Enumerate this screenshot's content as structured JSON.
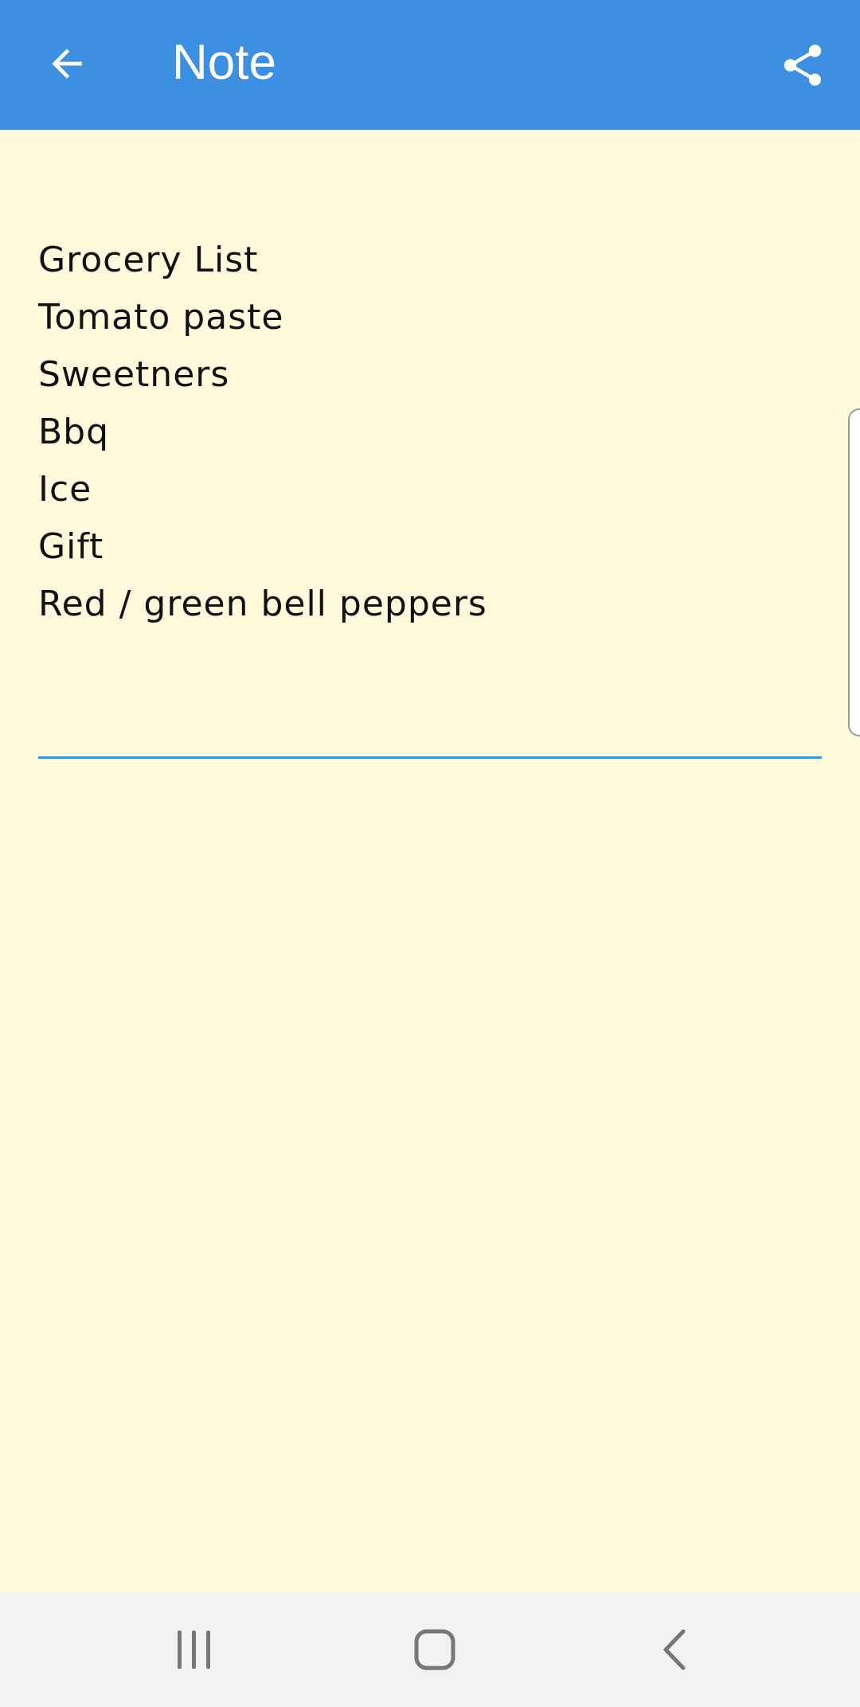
{
  "app_bar": {
    "title": "Note",
    "back_icon": "arrow-left-icon",
    "share_icon": "share-icon",
    "background_color": "#3D8FE2"
  },
  "note": {
    "lines": [
      "Grocery List",
      "Tomato paste",
      "Sweetners",
      "Bbq",
      "Ice",
      "Gift",
      "Red / green bell peppers"
    ],
    "background_color": "#FFFADC",
    "underline_color": "#3A9AD9"
  },
  "nav_bar": {
    "icons": [
      "recent-apps-icon",
      "home-icon",
      "back-icon"
    ]
  }
}
